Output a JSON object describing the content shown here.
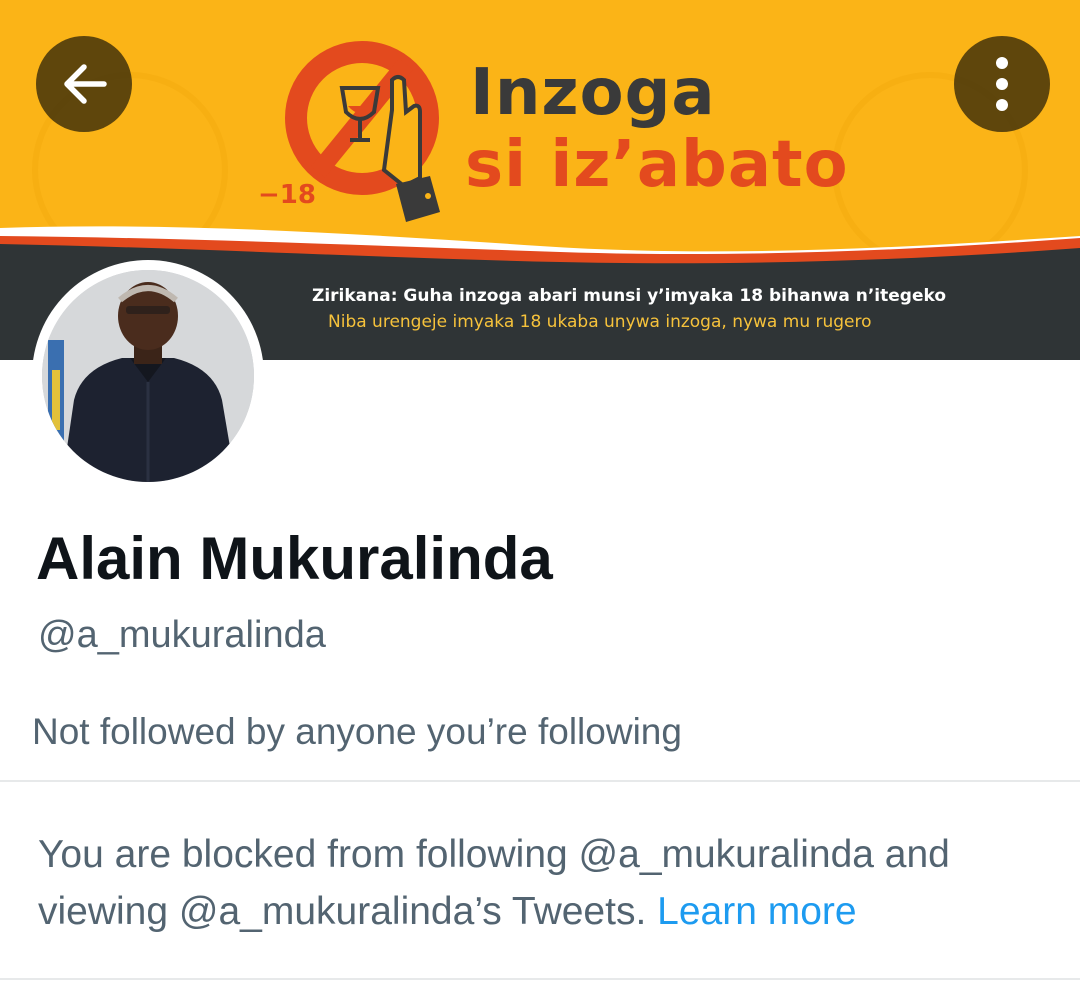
{
  "header": {
    "back_icon": "arrow-left-icon",
    "more_icon": "more-vertical-icon"
  },
  "banner": {
    "title_line1": "Inzoga",
    "title_line2": "si iz’abato",
    "age_label": "−18",
    "notice_line1": "Zirikana: Guha inzoga abari munsi y’imyaka 18 bihanwa n’itegeko",
    "notice_line2": "Niba urengeje imyaka 18 ukaba unywa inzoga, nywa mu rugero",
    "colors": {
      "yellow": "#fbb417",
      "orange": "#e34a1e",
      "dark": "#2f3436"
    }
  },
  "profile": {
    "display_name": "Alain Mukuralinda",
    "handle": "@a_mukuralinda",
    "followed_by": "Not followed by anyone you’re following"
  },
  "blocked_notice": {
    "text": "You are blocked from following @a_mukuralinda and viewing @a_mukuralinda’s Tweets.",
    "link": "Learn more",
    "link_color": "#1d9bf0"
  }
}
